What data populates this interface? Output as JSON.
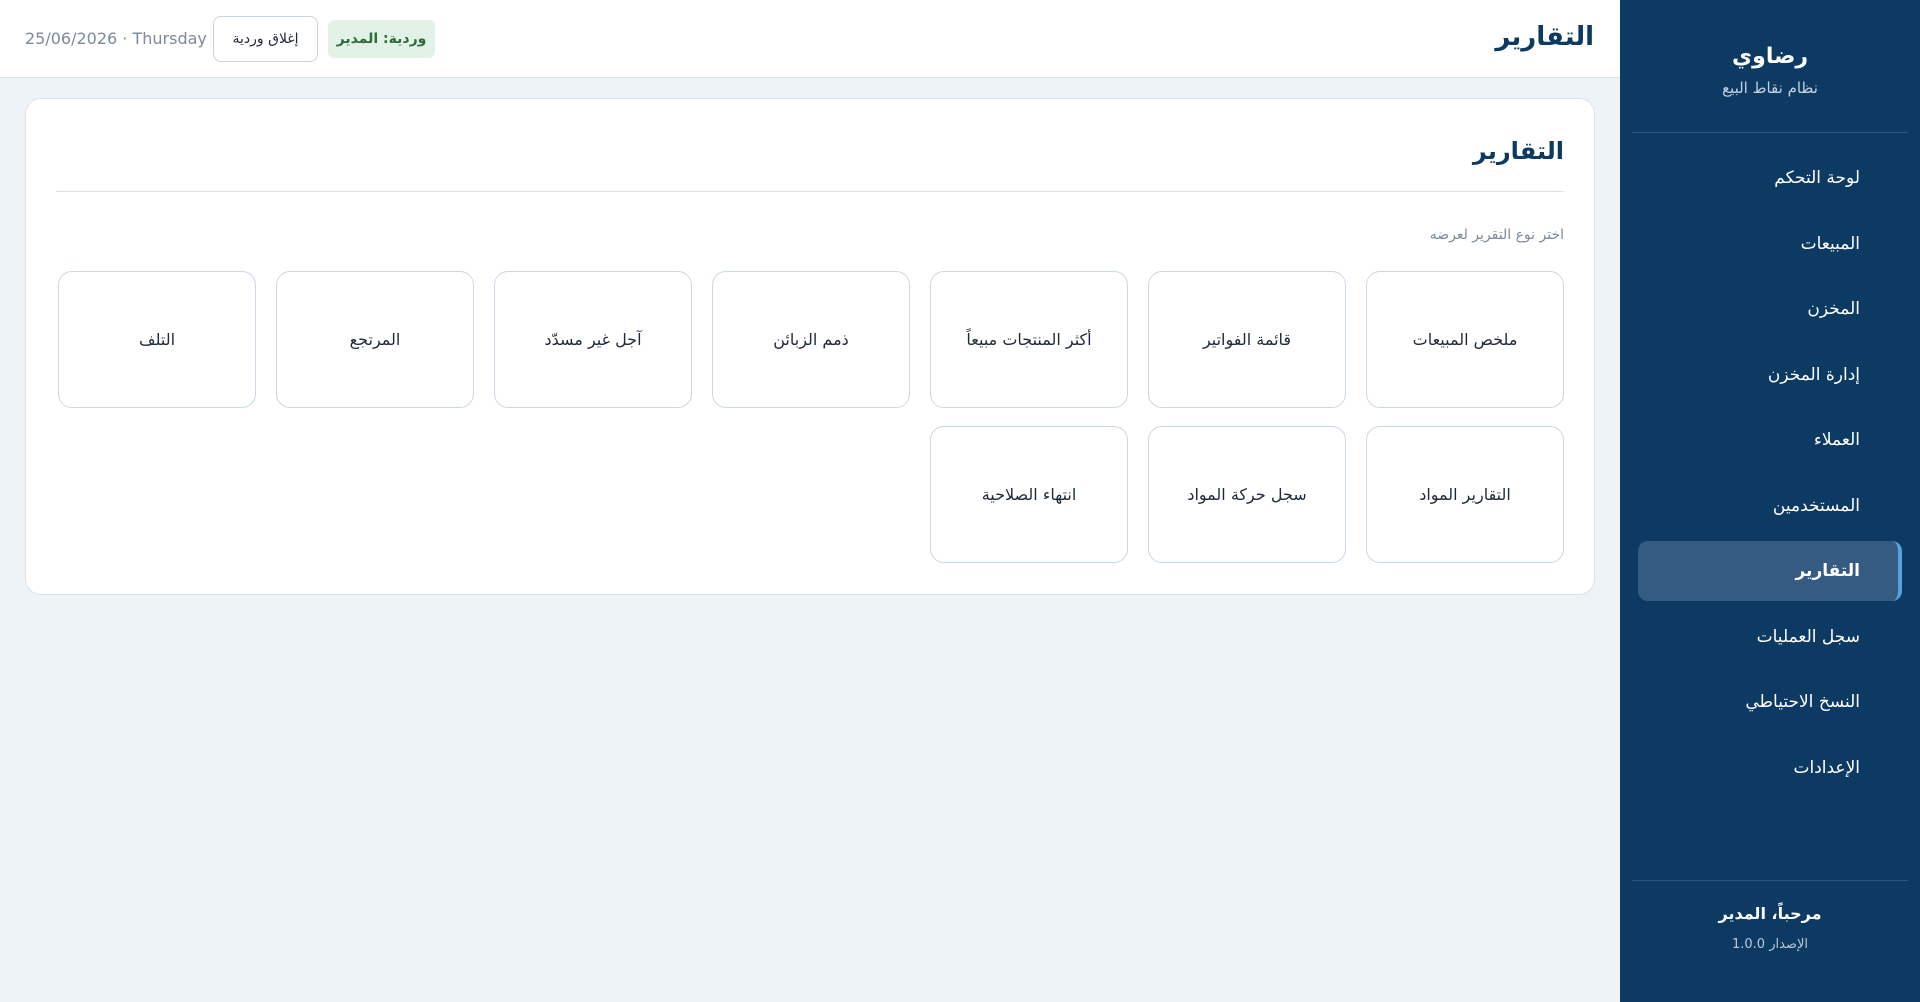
{
  "sidebar": {
    "brand_name": "رضاوي",
    "brand_subtitle": "نظام نقاط البيع",
    "items": [
      {
        "label": "لوحة التحكم"
      },
      {
        "label": "المبيعات"
      },
      {
        "label": "المخزن"
      },
      {
        "label": "إدارة المخزن"
      },
      {
        "label": "العملاء"
      },
      {
        "label": "المستخدمين"
      },
      {
        "label": "التقارير",
        "active": true
      },
      {
        "label": "سجل العمليات"
      },
      {
        "label": "النسخ الاحتياطي"
      },
      {
        "label": "الإعدادات"
      }
    ],
    "welcome": "مرحباً، المدير",
    "version": "الإصدار 1.0.0"
  },
  "topbar": {
    "title": "التقارير",
    "date": "25/06/2026 · Thursday",
    "close_shift_label": "إغلاق وردية",
    "shift_badge": "وردية: المدير"
  },
  "card": {
    "title": "التقارير",
    "hint": "اختر نوع التقرير لعرضه",
    "tiles": [
      {
        "label": "ملخص المبيعات"
      },
      {
        "label": "قائمة الفواتير"
      },
      {
        "label": "أكثر المنتجات مبيعاً"
      },
      {
        "label": "ذمم الزبائن"
      },
      {
        "label": "آجل غير مسدّد"
      },
      {
        "label": "المرتجع"
      },
      {
        "label": "التلف"
      },
      {
        "label": "التقارير المواد"
      },
      {
        "label": "سجل حركة المواد"
      },
      {
        "label": "انتهاء الصلاحية"
      }
    ]
  },
  "colors": {
    "sidebar_bg": "#0d3a62",
    "active_item_bg": "#355b83",
    "accent": "#5aa0dd",
    "page_bg": "#eef3f7",
    "badge_bg": "#e3f2e6",
    "badge_text": "#2e6b3a"
  }
}
